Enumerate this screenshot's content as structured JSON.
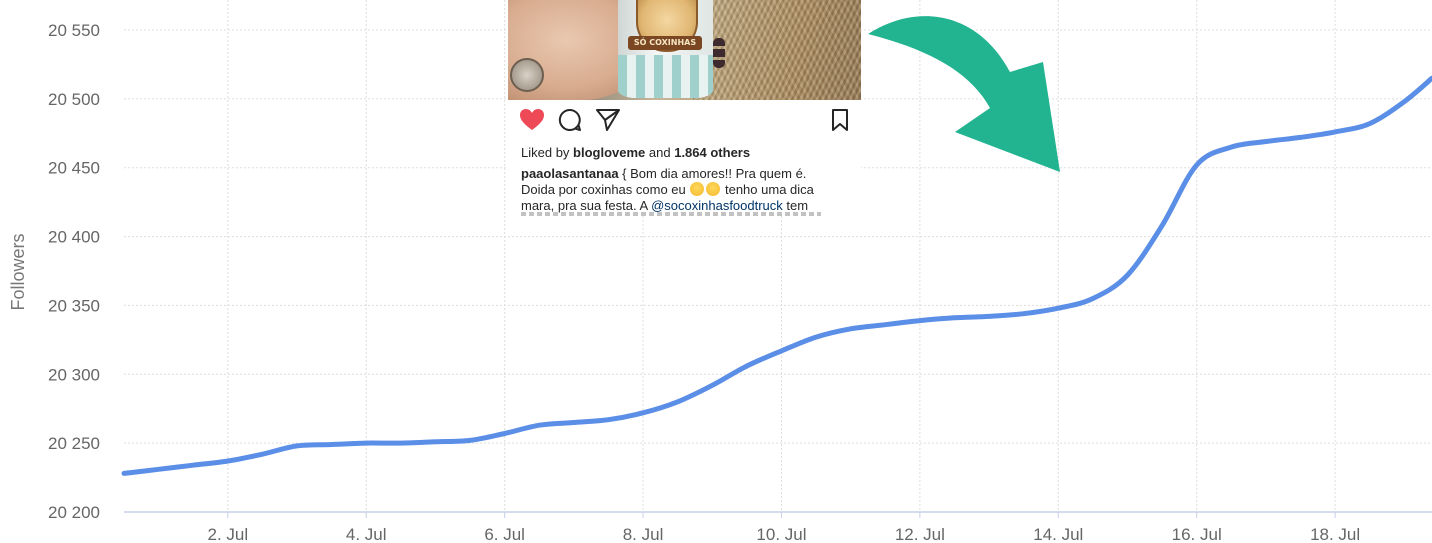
{
  "chart_data": {
    "type": "line",
    "title": "",
    "xlabel": "",
    "ylabel": "Followers",
    "ylim": [
      20200,
      20550
    ],
    "xlim": [
      0.5,
      19.4
    ],
    "y_ticks": [
      20200,
      20250,
      20300,
      20350,
      20400,
      20450,
      20500,
      20550
    ],
    "y_tick_labels": [
      "20 200",
      "20 250",
      "20 300",
      "20 350",
      "20 400",
      "20 450",
      "20 500",
      "20 550"
    ],
    "x_ticks": [
      2,
      4,
      6,
      8,
      10,
      12,
      14,
      16,
      18
    ],
    "x_tick_labels": [
      "2. Jul",
      "4. Jul",
      "6. Jul",
      "8. Jul",
      "10. Jul",
      "12. Jul",
      "14. Jul",
      "16. Jul",
      "18. Jul"
    ],
    "grid": true,
    "colors": {
      "line": "#5b8ee6",
      "grid": "#dddddd",
      "axis": "#c7d0e6"
    },
    "series": [
      {
        "values": [
          {
            "x": 0.5,
            "y": 20228
          },
          {
            "x": 1.0,
            "y": 20231
          },
          {
            "x": 1.5,
            "y": 20234
          },
          {
            "x": 2.0,
            "y": 20237
          },
          {
            "x": 2.5,
            "y": 20242
          },
          {
            "x": 3.0,
            "y": 20248
          },
          {
            "x": 3.5,
            "y": 20249
          },
          {
            "x": 4.0,
            "y": 20250
          },
          {
            "x": 4.5,
            "y": 20250
          },
          {
            "x": 5.0,
            "y": 20251
          },
          {
            "x": 5.5,
            "y": 20252
          },
          {
            "x": 6.0,
            "y": 20257
          },
          {
            "x": 6.5,
            "y": 20263
          },
          {
            "x": 7.0,
            "y": 20265
          },
          {
            "x": 7.5,
            "y": 20267
          },
          {
            "x": 8.0,
            "y": 20272
          },
          {
            "x": 8.5,
            "y": 20280
          },
          {
            "x": 9.0,
            "y": 20292
          },
          {
            "x": 9.5,
            "y": 20306
          },
          {
            "x": 10.0,
            "y": 20317
          },
          {
            "x": 10.5,
            "y": 20327
          },
          {
            "x": 11.0,
            "y": 20333
          },
          {
            "x": 11.5,
            "y": 20336
          },
          {
            "x": 12.0,
            "y": 20339
          },
          {
            "x": 12.5,
            "y": 20341
          },
          {
            "x": 13.0,
            "y": 20342
          },
          {
            "x": 13.5,
            "y": 20344
          },
          {
            "x": 14.0,
            "y": 20348
          },
          {
            "x": 14.5,
            "y": 20355
          },
          {
            "x": 15.0,
            "y": 20372
          },
          {
            "x": 15.5,
            "y": 20408
          },
          {
            "x": 16.0,
            "y": 20452
          },
          {
            "x": 16.5,
            "y": 20465
          },
          {
            "x": 17.0,
            "y": 20469
          },
          {
            "x": 17.5,
            "y": 20472
          },
          {
            "x": 18.0,
            "y": 20476
          },
          {
            "x": 18.5,
            "y": 20482
          },
          {
            "x": 19.0,
            "y": 20498
          },
          {
            "x": 19.4,
            "y": 20515
          }
        ]
      }
    ]
  },
  "post": {
    "cup_text": "SÓ COXINHAS",
    "likes": {
      "prefix": "Liked by ",
      "user": "blogloveme",
      "middle": " and ",
      "count": "1.864 others"
    },
    "caption": {
      "user": "paaolasantanaa",
      "text1": " { Bom dia amores!! Pra quem é. Doida por coxinhas como eu ",
      "text2": "  tenho uma dica mara, pra sua festa. A ",
      "mention": "@socoxinhasfoodtruck",
      "text3": " tem"
    },
    "icons": {
      "like": "heart-icon",
      "comment": "comment-icon",
      "share": "share-icon",
      "save": "bookmark-icon"
    },
    "heart_color": "#ed4956"
  },
  "annotation": {
    "arrow_color": "#22b390"
  }
}
